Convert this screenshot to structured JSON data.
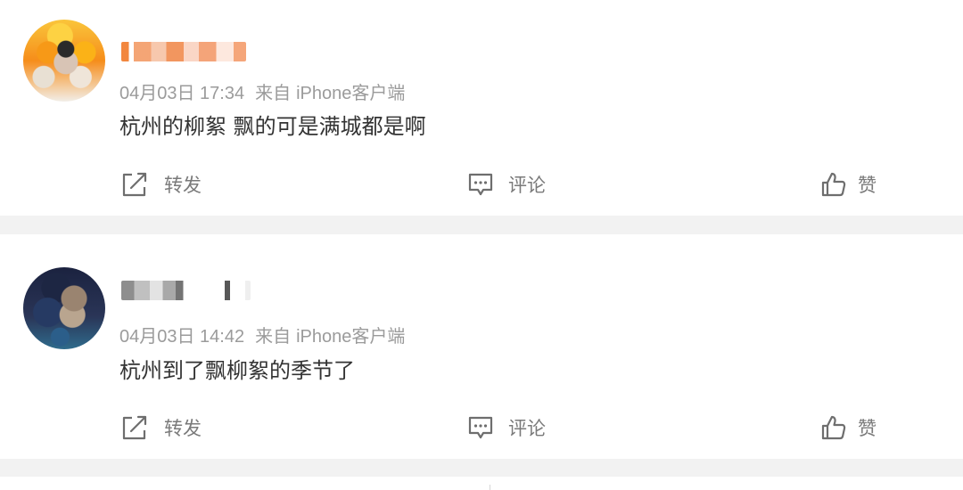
{
  "posts": [
    {
      "timestamp": "04月03日 17:34",
      "source_label": "来自",
      "device": "iPhone客户端",
      "content": "杭州的柳絮 飘的可是满城都是啊",
      "actions": {
        "repost": "转发",
        "comment": "评论",
        "like": "赞"
      }
    },
    {
      "timestamp": "04月03日 14:42",
      "source_label": "来自",
      "device": "iPhone客户端",
      "content": "杭州到了飘柳絮的季节了",
      "actions": {
        "repost": "转发",
        "comment": "评论",
        "like": "赞"
      }
    }
  ],
  "icons": {
    "repost": "share-out-icon",
    "comment": "comment-bubble-icon",
    "like": "thumbs-up-icon"
  },
  "colors": {
    "text_primary": "#333333",
    "text_meta": "#9b9b9b",
    "action": "#7a7a7a",
    "separator": "#f2f2f2"
  }
}
